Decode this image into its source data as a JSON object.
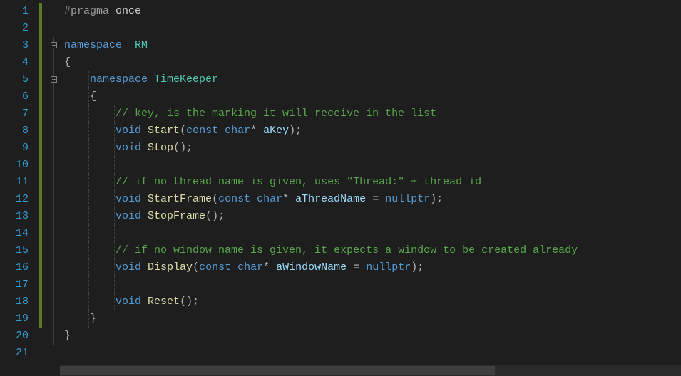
{
  "lineCount": 21,
  "greenLines": [
    1,
    2,
    3,
    4,
    5,
    6,
    7,
    8,
    9,
    10,
    11,
    12,
    13,
    14,
    15,
    16,
    17,
    18,
    19
  ],
  "foldBoxes": [
    3,
    5
  ],
  "code": {
    "l1": {
      "pragma": "#pragma",
      "once": "once"
    },
    "l3": {
      "kw": "namespace",
      "name": "RM"
    },
    "l4": {
      "brace": "{"
    },
    "l5": {
      "kw": "namespace",
      "name": "TimeKeeper"
    },
    "l6": {
      "brace": "{"
    },
    "l7": {
      "comment": "// key, is the marking it will receive in the list"
    },
    "l8": {
      "ret": "void",
      "fn": "Start",
      "lp": "(",
      "kconst": "const",
      "kchar": "char",
      "star": "*",
      "param": "aKey",
      "rp": ");"
    },
    "l9": {
      "ret": "void",
      "fn": "Stop",
      "rest": "();"
    },
    "l11": {
      "c1": "// if no thread name is given, uses ",
      "s": "\"Thread:\"",
      "c2": " + thread id"
    },
    "l12": {
      "ret": "void",
      "fn": "StartFrame",
      "lp": "(",
      "kconst": "const",
      "kchar": "char",
      "star": "*",
      "param": "aThreadName",
      "eq": " = ",
      "knull": "nullptr",
      "rp": ");"
    },
    "l13": {
      "ret": "void",
      "fn": "StopFrame",
      "rest": "();"
    },
    "l15": {
      "comment": "// if no window name is given, it expects a window to be created already"
    },
    "l16": {
      "ret": "void",
      "fn": "Display",
      "lp": "(",
      "kconst": "const",
      "kchar": "char",
      "star": "*",
      "param": "aWindowName",
      "eq": " = ",
      "knull": "nullptr",
      "rp": ");"
    },
    "l18": {
      "ret": "void",
      "fn": "Reset",
      "rest": "();"
    },
    "l19": {
      "brace": "}"
    },
    "l20": {
      "brace": "}"
    }
  }
}
